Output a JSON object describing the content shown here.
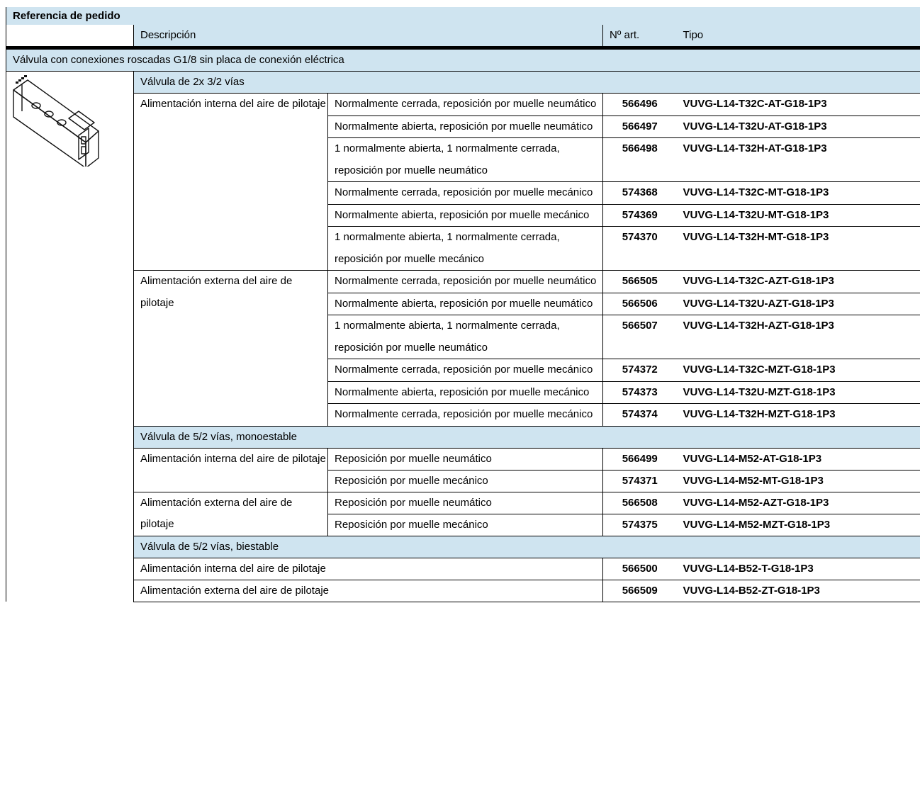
{
  "title": "Referencia de pedido",
  "headers": {
    "desc": "Descripción",
    "art": "Nº art.",
    "tipo": "Tipo"
  },
  "section": "Válvula con conexiones roscadas G1/8 sin placa de conexión eléctrica",
  "image": {
    "icon": "valve-image"
  },
  "groups": [
    {
      "title": "Válvula de 2x 3/2 vías",
      "supplies": [
        {
          "label": "Alimentación interna del aire de pilotaje",
          "rows": [
            {
              "desc": "Normalmente cerrada, reposición por muelle neumático",
              "art": "566496",
              "type": "VUVG-L14-T32C-AT-G18-1P3"
            },
            {
              "desc": "Normalmente abierta, reposición por muelle neumático",
              "art": "566497",
              "type": "VUVG-L14-T32U-AT-G18-1P3"
            },
            {
              "desc": "1 normalmente abierta, 1 normalmente cerrada, reposición por muelle neumático",
              "art": "566498",
              "type": "VUVG-L14-T32H-AT-G18-1P3"
            },
            {
              "desc": "Normalmente cerrada, reposición por muelle mecánico",
              "art": "574368",
              "type": "VUVG-L14-T32C-MT-G18-1P3"
            },
            {
              "desc": "Normalmente abierta, reposición por muelle mecánico",
              "art": "574369",
              "type": "VUVG-L14-T32U-MT-G18-1P3"
            },
            {
              "desc": "1 normalmente abierta, 1 normalmente cerrada, reposición por muelle mecánico",
              "art": "574370",
              "type": "VUVG-L14-T32H-MT-G18-1P3"
            }
          ]
        },
        {
          "label": "Alimentación externa del aire de pilotaje",
          "rows": [
            {
              "desc": "Normalmente cerrada, reposición por muelle neumático",
              "art": "566505",
              "type": "VUVG-L14-T32C-AZT-G18-1P3"
            },
            {
              "desc": "Normalmente abierta, reposición por muelle neumático",
              "art": "566506",
              "type": "VUVG-L14-T32U-AZT-G18-1P3"
            },
            {
              "desc": "1 normalmente abierta, 1 normalmente cerrada, reposición por muelle neumático",
              "art": "566507",
              "type": "VUVG-L14-T32H-AZT-G18-1P3"
            },
            {
              "desc": "Normalmente cerrada, reposición por muelle mecánico",
              "art": "574372",
              "type": "VUVG-L14-T32C-MZT-G18-1P3"
            },
            {
              "desc": "Normalmente abierta, reposición por muelle mecánico",
              "art": "574373",
              "type": "VUVG-L14-T32U-MZT-G18-1P3"
            },
            {
              "desc": "Normalmente cerrada, reposición por muelle mecánico",
              "art": "574374",
              "type": "VUVG-L14-T32H-MZT-G18-1P3"
            }
          ]
        }
      ]
    },
    {
      "title": "Válvula de 5/2 vías, monoestable",
      "supplies": [
        {
          "label": "Alimentación interna del aire de pilotaje",
          "rows": [
            {
              "desc": "Reposición por muelle neumático",
              "art": "566499",
              "type": "VUVG-L14-M52-AT-G18-1P3"
            },
            {
              "desc": "Reposición por muelle mecánico",
              "art": "574371",
              "type": "VUVG-L14-M52-MT-G18-1P3"
            }
          ]
        },
        {
          "label": "Alimentación externa del aire de pilotaje",
          "rows": [
            {
              "desc": "Reposición por muelle neumático",
              "art": "566508",
              "type": "VUVG-L14-M52-AZT-G18-1P3"
            },
            {
              "desc": "Reposición por muelle mecánico",
              "art": "574375",
              "type": "VUVG-L14-M52-MZT-G18-1P3"
            }
          ]
        }
      ]
    },
    {
      "title": "Válvula de 5/2 vías, biestable",
      "rows": [
        {
          "desc": "Alimentación interna del aire de pilotaje",
          "art": "566500",
          "type": "VUVG-L14-B52-T-G18-1P3"
        },
        {
          "desc": "Alimentación externa del aire de pilotaje",
          "art": "566509",
          "type": "VUVG-L14-B52-ZT-G18-1P3"
        }
      ]
    }
  ]
}
